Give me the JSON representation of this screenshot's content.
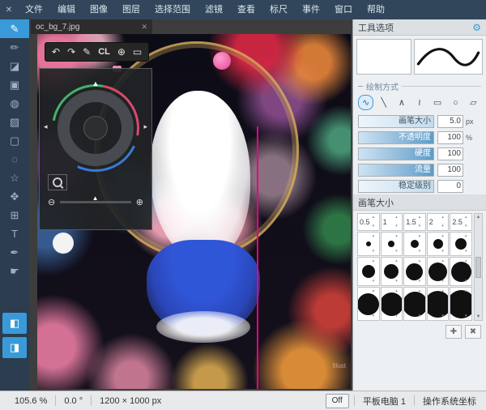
{
  "colors": {
    "accent": "#3a9ad9"
  },
  "menubar": {
    "close_icon": "✕",
    "items": [
      "文件",
      "编辑",
      "图像",
      "图层",
      "选择范围",
      "滤镜",
      "查看",
      "标尺",
      "事件",
      "窗口",
      "帮助"
    ]
  },
  "toolbar": {
    "glyphs": [
      "✎",
      "✏",
      "◪",
      "▣",
      "◍",
      "▨",
      "▢",
      "◌",
      "☆",
      "✥",
      "⊞",
      "T",
      "✒",
      "☛",
      "◧",
      "◨"
    ]
  },
  "canvas": {
    "tab_title": "oc_bg_7.jpg",
    "tab_close_icon": "✕",
    "watermark": "Illust",
    "float_toolbar": {
      "undo": "↶",
      "redo": "↷",
      "pen": "✎",
      "cl": "CL",
      "target": "⊕",
      "display": "▭"
    },
    "navigator": {
      "marker": "▲",
      "left": "◂",
      "right": "▸",
      "zoom_in": "⊕",
      "zoom_out": "⊖",
      "thumb": "▲"
    }
  },
  "right_panel": {
    "tool_options_title": "工具选项",
    "gear_icon": "⚙",
    "draw_mode_title": "绘制方式",
    "draw_icons": [
      "∿",
      "╲",
      "∧",
      "≀",
      "▭",
      "○",
      "▱"
    ],
    "sliders": [
      {
        "label": "画笔大小",
        "value": "5.0",
        "unit": "px"
      },
      {
        "label": "不透明度",
        "value": "100",
        "unit": "%"
      },
      {
        "label": "硬度",
        "value": "100",
        "unit": ""
      },
      {
        "label": "流量",
        "value": "100",
        "unit": ""
      },
      {
        "label": "稳定级别",
        "value": "0",
        "unit": ""
      }
    ],
    "brush_panel_title": "画笔大小",
    "brush_values": [
      "0.5",
      "1",
      "1.5",
      "2",
      "2.5"
    ],
    "scroll_up": "▲",
    "scroll_down": "▼",
    "add_icon": "✚",
    "delete_icon": "✖"
  },
  "statusbar": {
    "zoom": "105.6 %",
    "rotation": "0.0 °",
    "size": "1200 × 1000 px",
    "toggle": "Off",
    "tablet": "平板电脑 1",
    "coords": "操作系统坐标"
  }
}
